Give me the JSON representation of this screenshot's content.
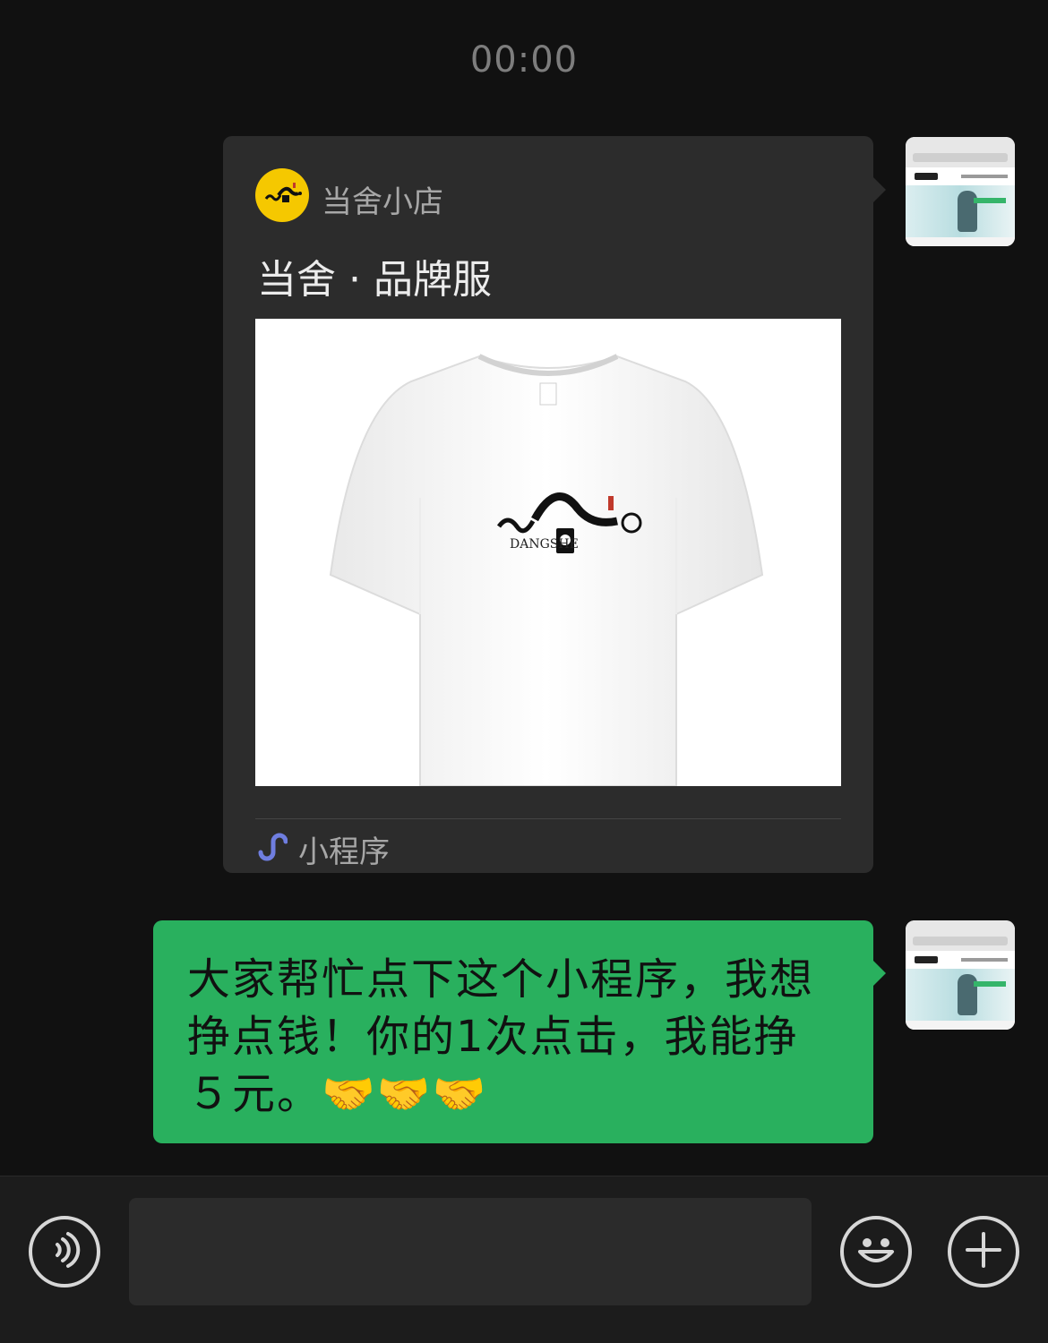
{
  "chat": {
    "timestamp": "00:00",
    "messages": [
      {
        "type": "mini_program_card",
        "sender": "self",
        "app_name": "当舍小店",
        "title": "当舍 · 品牌服",
        "image_logo_text": "DANGSHE",
        "source_label": "小程序"
      },
      {
        "type": "text",
        "sender": "self",
        "text": "大家帮忙点下这个小程序，我想挣点钱！你的1次点击，我能挣５元。🤝🤝🤝"
      }
    ]
  },
  "input_bar": {
    "voice_icon": "voice-icon",
    "emoji_icon": "emoji-icon",
    "plus_icon": "plus-icon",
    "input_value": ""
  },
  "colors": {
    "background": "#111111",
    "card": "#2c2c2c",
    "bubble_green": "#29b05e",
    "brand_yellow": "#f5c800",
    "link_icon": "#6f7ee0"
  }
}
